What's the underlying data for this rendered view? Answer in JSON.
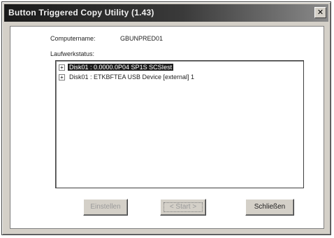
{
  "window": {
    "title": "Button Triggered Copy Utility (1.43)",
    "close_glyph": "✕"
  },
  "computer": {
    "label": "Computername:",
    "value": "GBUNPRED01"
  },
  "drives": {
    "label": "Laufwerkstatus:",
    "items": [
      {
        "text": "Disk01 : 0.0000.0P04 SP1S SCSIest",
        "selected": true
      },
      {
        "text": "Disk01 : ETKBFTEA USB Device [external] 1",
        "selected": false
      }
    ]
  },
  "buttons": {
    "settings": "Einstellen",
    "start": "< Start >",
    "close": "Schließen"
  }
}
